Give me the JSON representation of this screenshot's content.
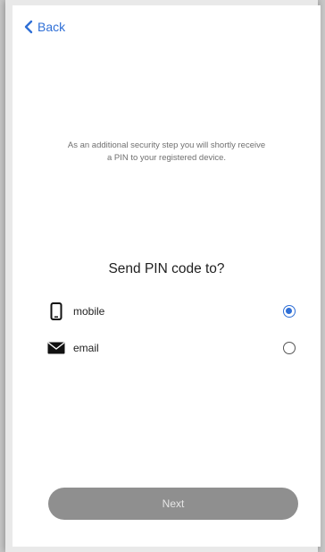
{
  "nav": {
    "back_label": "Back"
  },
  "info": {
    "line1": "As an additional security step you will shortly receive",
    "line2": "a PIN to your registered device."
  },
  "prompt": "Send PIN code to?",
  "options": [
    {
      "label": "mobile",
      "icon": "mobile-phone-icon",
      "selected": true
    },
    {
      "label": "email",
      "icon": "envelope-icon",
      "selected": false
    }
  ],
  "next_label": "Next",
  "colors": {
    "accent": "#2f6fd6",
    "button_bg": "#8f8f8f",
    "button_text": "#e6e6e6"
  }
}
